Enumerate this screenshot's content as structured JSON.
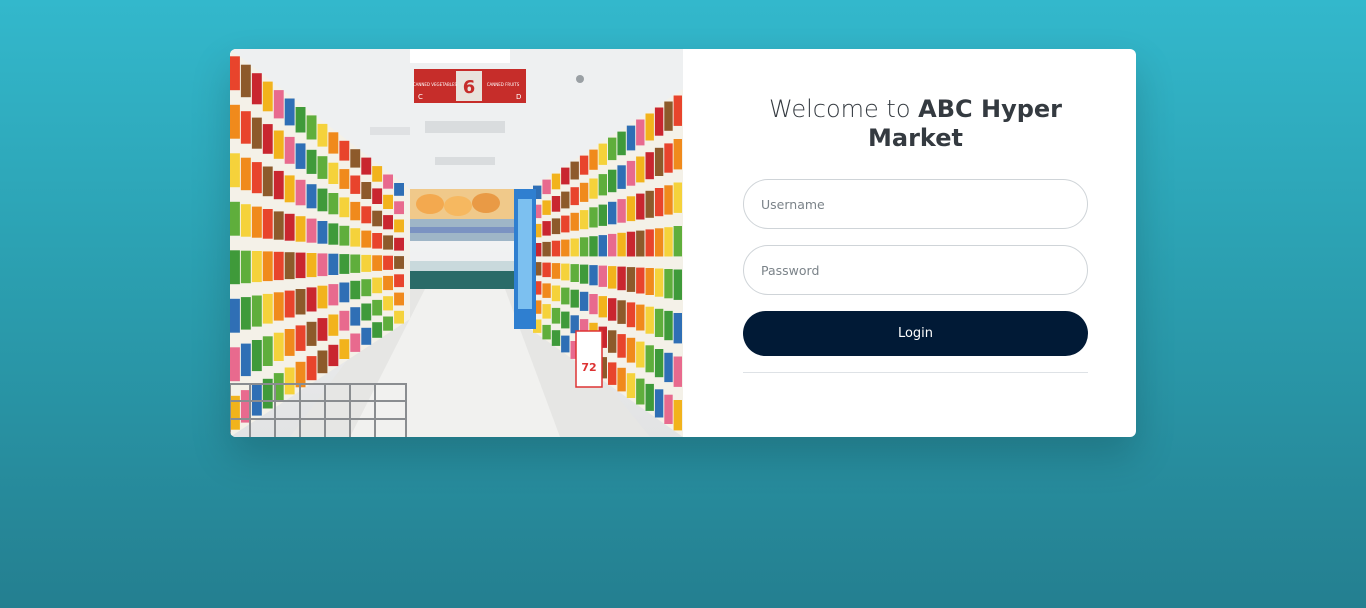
{
  "login": {
    "title_prefix": "Welcome to ",
    "title_brand": "ABC Hyper Market",
    "username_placeholder": "Username",
    "password_placeholder": "Password",
    "login_button": "Login"
  },
  "photo": {
    "aisle_sign_left": "CANNED VEGETABLES",
    "aisle_sign_number": "6",
    "aisle_sign_right": "CANNED FRUITS",
    "aisle_sign_letter_left": "C",
    "aisle_sign_letter_right": "D",
    "price_tag": "72"
  },
  "colors": {
    "background_top": "#33b8cc",
    "background_bottom": "#247f90",
    "login_button": "#011a36",
    "card": "#ffffff"
  }
}
